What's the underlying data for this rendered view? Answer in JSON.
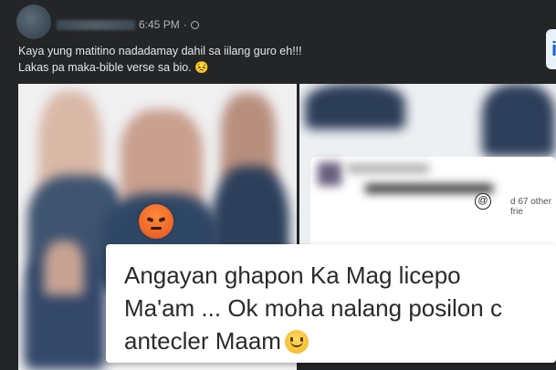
{
  "post": {
    "timestamp": "6:45 PM",
    "caption_line1": "Kaya yung matitino nadadamay dahil sa iilang guro eh!!!",
    "caption_line2": "Lakas pa maka-bible verse sa bio.",
    "caption_emoji": "😣"
  },
  "side_badge": "i",
  "embedded_screenshot": {
    "mention_text": "d 67 other frie",
    "mention_icon": "@"
  },
  "comment": {
    "line1": "Angayan ghapon Ka Mag licepo",
    "line2": "Ma'am ... Ok moha nalang posilon c",
    "line3": "antecler Maam"
  },
  "colors": {
    "post_bg": "#242526",
    "caption_text": "#e4e6eb",
    "reaction_angry": "#e5541b",
    "comment_bg": "#ffffff"
  }
}
